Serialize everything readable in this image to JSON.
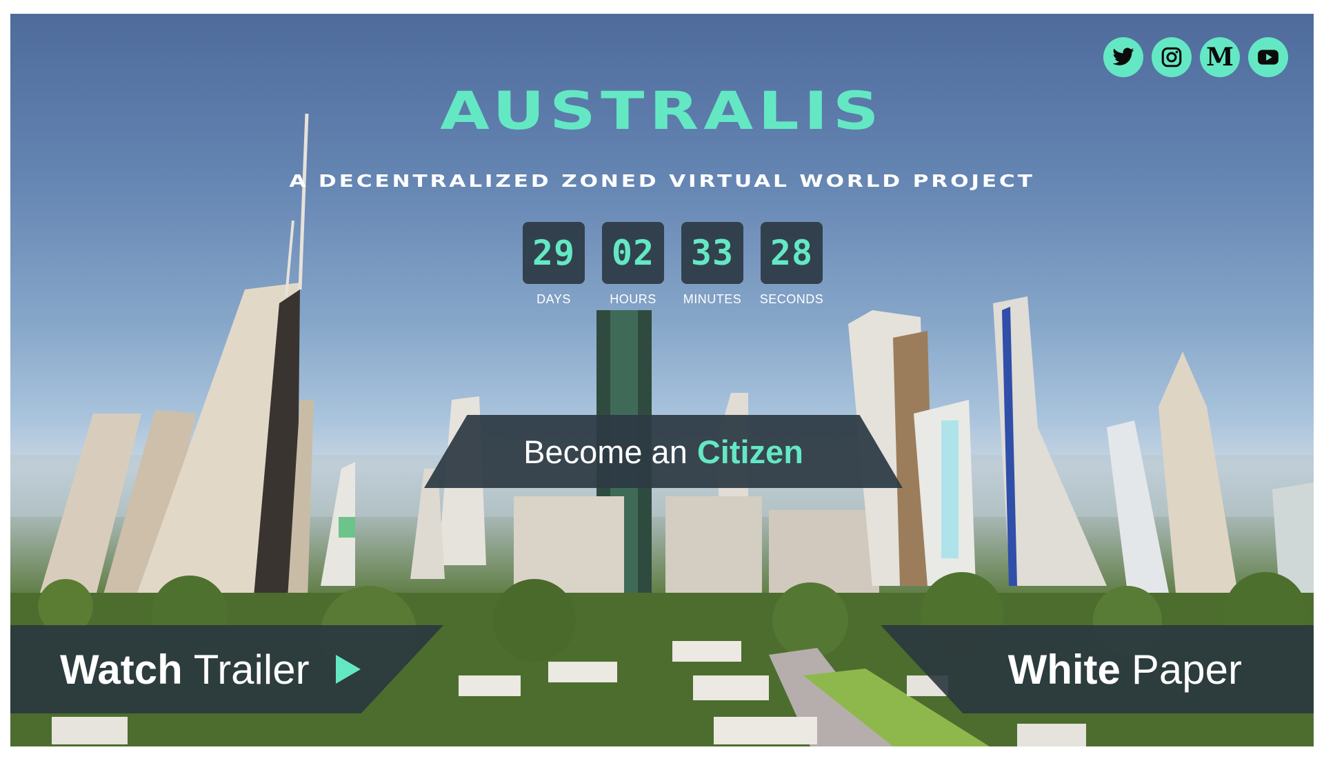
{
  "brand": {
    "title": "AUSTRALIS",
    "subtitle": "A DECENTRALIZED ZONED VIRTUAL WORLD PROJECT"
  },
  "colors": {
    "accent": "#64e8c4",
    "panel": "#2d3a44",
    "text": "#ffffff"
  },
  "social": [
    {
      "name": "twitter",
      "icon": "twitter-icon"
    },
    {
      "name": "instagram",
      "icon": "instagram-icon"
    },
    {
      "name": "medium",
      "icon": "medium-icon",
      "glyph": "M"
    },
    {
      "name": "youtube",
      "icon": "youtube-icon"
    }
  ],
  "countdown": {
    "days": {
      "value": "29",
      "label": "DAYS"
    },
    "hours": {
      "value": "02",
      "label": "HOURS"
    },
    "minutes": {
      "value": "33",
      "label": "MINUTES"
    },
    "seconds": {
      "value": "28",
      "label": "SECONDS"
    }
  },
  "citizen_cta": {
    "prefix": "Become an",
    "accent": "Citizen"
  },
  "watch_trailer": {
    "bold": "Watch",
    "regular": "Trailer",
    "icon": "play-icon"
  },
  "white_paper": {
    "bold": "White",
    "regular": "Paper"
  }
}
